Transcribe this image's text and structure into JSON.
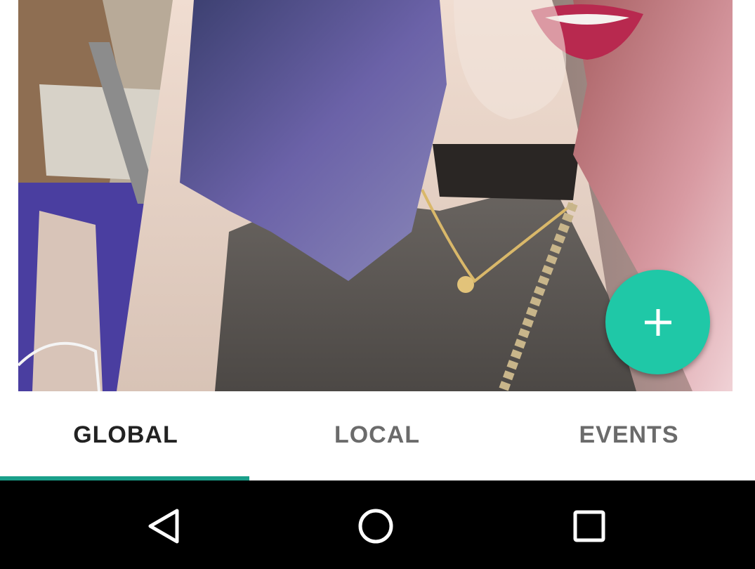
{
  "tabs": [
    {
      "label": "GLOBAL",
      "active": true
    },
    {
      "label": "LOCAL",
      "active": false
    },
    {
      "label": "EVENTS",
      "active": false
    }
  ],
  "fab": {
    "icon": "plus-icon",
    "color": "#1fc8a7"
  },
  "colors": {
    "accent": "#1fc8a7",
    "tab_indicator": "#1a9f8a",
    "tab_active_text": "#222222",
    "tab_inactive_text": "#6b6b6b",
    "navbar_background": "#000000"
  },
  "navigation": {
    "back_icon": "back-triangle-icon",
    "home_icon": "home-circle-icon",
    "recents_icon": "recents-square-icon"
  },
  "photo": {
    "icon": "photo-image"
  }
}
